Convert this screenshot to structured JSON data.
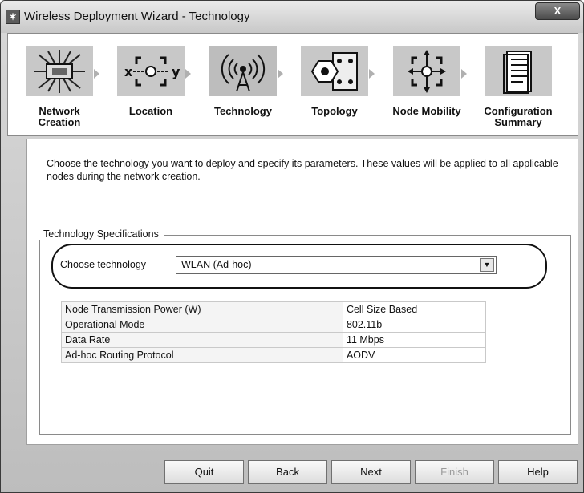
{
  "window": {
    "title": "Wireless Deployment Wizard - Technology",
    "close_label": "X"
  },
  "steps": [
    {
      "label": "Network Creation",
      "icon": "network-creation-icon"
    },
    {
      "label": "Location",
      "icon": "location-icon"
    },
    {
      "label": "Technology",
      "icon": "wireless-antenna-icon"
    },
    {
      "label": "Topology",
      "icon": "topology-icon"
    },
    {
      "label": "Node Mobility",
      "icon": "node-mobility-icon"
    },
    {
      "label": "Configuration Summary",
      "icon": "configuration-summary-icon"
    }
  ],
  "intro_text": "Choose the technology you want to deploy and specify its parameters. These values will be applied to all applicable nodes during the network creation.",
  "tech_spec": {
    "group_title": "Technology Specifications",
    "choose_label": "Choose technology",
    "selected": "WLAN (Ad-hoc)",
    "params": [
      {
        "name": "Node Transmission Power (W)",
        "value": "Cell Size Based"
      },
      {
        "name": "Operational Mode",
        "value": "802.11b"
      },
      {
        "name": "Data Rate",
        "value": "11 Mbps"
      },
      {
        "name": "Ad-hoc Routing Protocol",
        "value": "AODV"
      }
    ]
  },
  "buttons": {
    "quit": "Quit",
    "back": "Back",
    "next": "Next",
    "finish": "Finish",
    "help": "Help"
  }
}
